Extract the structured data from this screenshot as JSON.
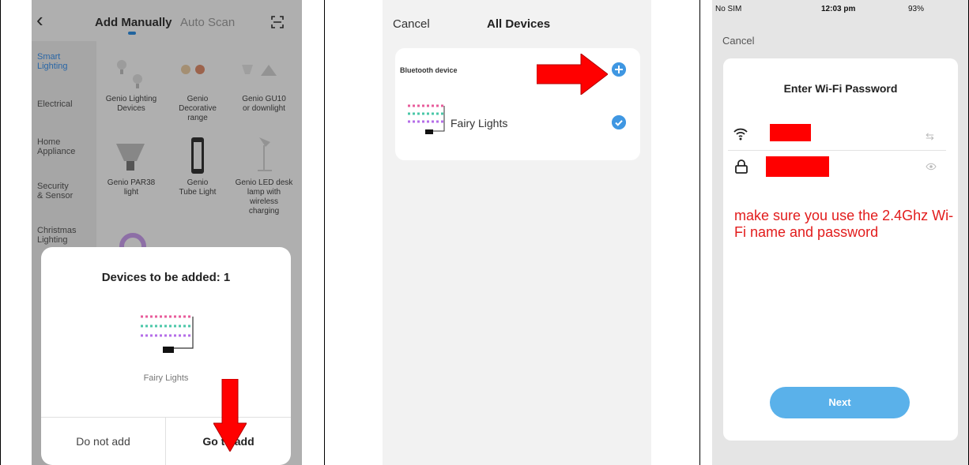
{
  "panel1": {
    "tabs": {
      "add_manually": "Add Manually",
      "auto_scan": "Auto Scan"
    },
    "categories": [
      {
        "label": "Smart\nLighting"
      },
      {
        "label": "Electrical"
      },
      {
        "label": "Home\nAppliance"
      },
      {
        "label": "Security\n& Sensor"
      },
      {
        "label": "Christmas\nLighting"
      }
    ],
    "devices": [
      {
        "label": "Genio Lighting\nDevices"
      },
      {
        "label": "Genio\nDecorative\nrange"
      },
      {
        "label": "Genio GU10\nor downlight"
      },
      {
        "label": "Genio PAR38\nlight"
      },
      {
        "label": "Genio\nTube Light"
      },
      {
        "label": "Genio LED desk\nlamp with\nwireless\ncharging"
      }
    ],
    "sheet": {
      "title": "Devices to be added: 1",
      "device_name": "Fairy Lights",
      "do_not_add": "Do not add",
      "go_to_add": "Go to add"
    }
  },
  "panel2": {
    "cancel": "Cancel",
    "title": "All Devices",
    "section_label": "Bluetooth device",
    "device_name": "Fairy Lights"
  },
  "panel3": {
    "status": {
      "carrier": "No SIM",
      "time": "12:03 pm",
      "battery": "93%"
    },
    "cancel": "Cancel",
    "title": "Enter Wi-Fi Password",
    "note": "make sure you use the 2.4Ghz Wi-Fi name and password",
    "next": "Next"
  },
  "colors": {
    "accent": "#3f97e2",
    "arrow": "#ff0000",
    "note": "#e21c1c",
    "redaction": "#ff0000"
  }
}
